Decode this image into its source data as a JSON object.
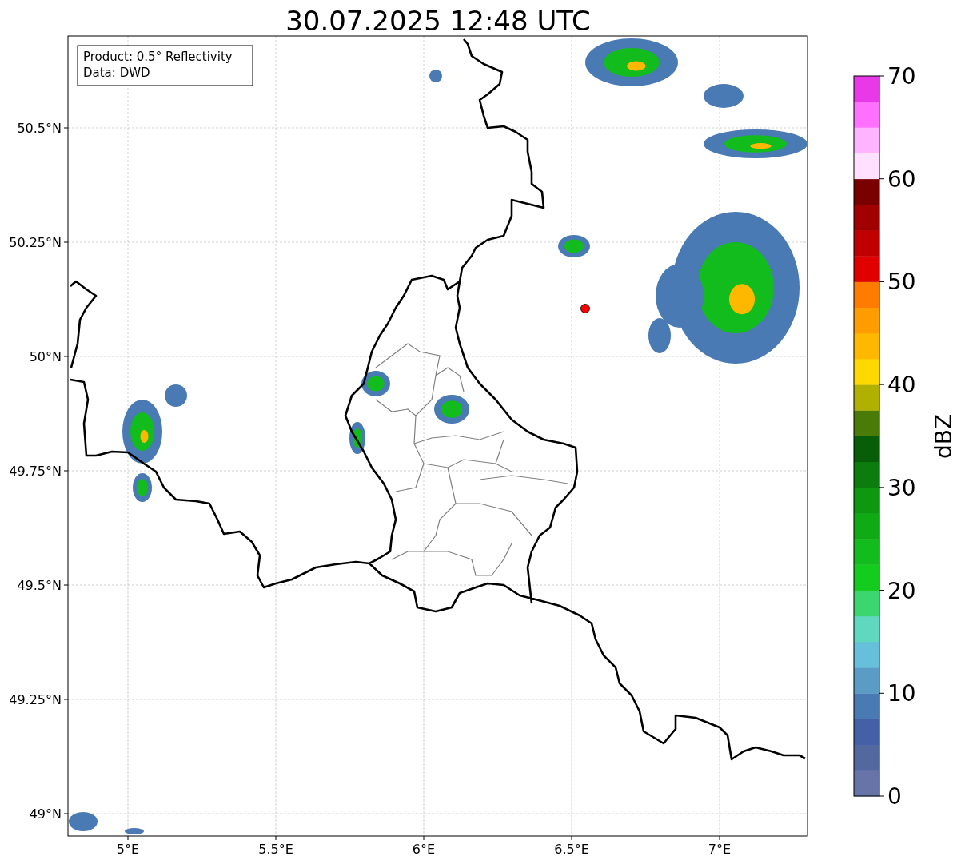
{
  "title": "30.07.2025 12:48 UTC",
  "legend": [
    "Product: 0.5° Reflectivity",
    "Data: DWD"
  ],
  "y_ticks": [
    "50.5°N",
    "50.25°N",
    "50°N",
    "49.75°N",
    "49.5°N",
    "49.25°N",
    "49°N"
  ],
  "x_ticks": [
    "5°E",
    "5.5°E",
    "6°E",
    "6.5°E",
    "7°E"
  ],
  "colorbar": {
    "label": "dBZ",
    "ticks": [
      "70",
      "60",
      "50",
      "40",
      "30",
      "20",
      "10",
      "0"
    ],
    "bins": [
      {
        "color": "#6674a8"
      },
      {
        "color": "#5468a0"
      },
      {
        "color": "#4460a6"
      },
      {
        "color": "#4a7ab4"
      },
      {
        "color": "#5a9cc6"
      },
      {
        "color": "#66c0dc"
      },
      {
        "color": "#60d8c0"
      },
      {
        "color": "#3cd670"
      },
      {
        "color": "#14cc1e"
      },
      {
        "color": "#12bc1c"
      },
      {
        "color": "#10aa14"
      },
      {
        "color": "#0e9810"
      },
      {
        "color": "#0c7c0e"
      },
      {
        "color": "#085e08"
      },
      {
        "color": "#4a7a08"
      },
      {
        "color": "#b0b000"
      },
      {
        "color": "#ffd800"
      },
      {
        "color": "#ffb800"
      },
      {
        "color": "#ff9c00"
      },
      {
        "color": "#ff7c00"
      },
      {
        "color": "#e00000"
      },
      {
        "color": "#c00000"
      },
      {
        "color": "#a00000"
      },
      {
        "color": "#7a0000"
      },
      {
        "color": "#ffe0ff"
      },
      {
        "color": "#ffb4ff"
      },
      {
        "color": "#ff70ff"
      },
      {
        "color": "#e838e8"
      }
    ]
  }
}
